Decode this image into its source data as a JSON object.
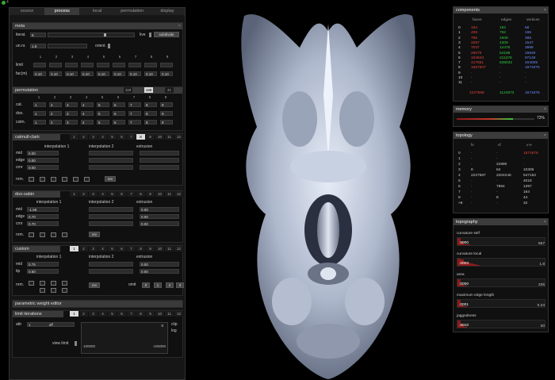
{
  "window": {
    "indicator": "4"
  },
  "tabs": [
    "source",
    "process",
    "local",
    "permutation",
    "display"
  ],
  "meta": {
    "title": "meta",
    "iterat_label": "iterat.",
    "iterat_value": "8",
    "live_label": "live",
    "subdivide_label": "subdivide",
    "unnr_label": "un.nr.",
    "unnr_value": "1.8",
    "orient_label": "orient.",
    "cols": [
      "1",
      "2",
      "3",
      "4",
      "5",
      "6",
      "7",
      "8",
      "9"
    ],
    "limit_label": "limit",
    "fac_label": "fac(m)",
    "fac_values": [
      "0.10",
      "0.10",
      "0.10",
      "0.10",
      "0.10",
      "0.10",
      "0.10",
      "0.10",
      "0.10"
    ]
  },
  "permutation": {
    "title": "permutation",
    "tabs": [
      "119",
      "188",
      "41"
    ],
    "cols": [
      "1",
      "2",
      "3",
      "4",
      "5",
      "6",
      "7",
      "8",
      "9"
    ],
    "rows": [
      {
        "label": "cat.",
        "values": [
          "1",
          "2",
          "3",
          "4",
          "5",
          "6",
          "7",
          "8",
          "9"
        ]
      },
      {
        "label": "doo.",
        "values": [
          "1",
          "2",
          "3",
          "4",
          "5",
          "6",
          "7",
          "8",
          "9"
        ]
      },
      {
        "label": "cstm.",
        "values": [
          "1",
          "2",
          "3",
          "4",
          "5",
          "6",
          "7",
          "8",
          "9"
        ]
      }
    ]
  },
  "catmull": {
    "title": "catmull-clark",
    "tabs": [
      "1",
      "2",
      "3",
      "4",
      "5",
      "6",
      "7",
      "8",
      "9",
      "10",
      "11",
      "12"
    ],
    "interp1": "interpolation 1",
    "interp2": "interpolation 2",
    "extrusion": "extrusion",
    "rows": [
      {
        "label": "mid",
        "v": "0.00"
      },
      {
        "label": "edge",
        "v": "0.00"
      },
      {
        "label": "crnr",
        "v": "0.00"
      }
    ],
    "nrm_label": "nrm.",
    "rev_label": "rev"
  },
  "doosabin": {
    "title": "doo-sabin",
    "tabs": [
      "1",
      "2",
      "3",
      "4",
      "5",
      "6",
      "7",
      "8",
      "9",
      "10",
      "11",
      "12"
    ],
    "interp1": "interpolation 1",
    "interp2": "interpolation 2",
    "extrusion": "extrusion",
    "rows": [
      {
        "label": "mid",
        "v": "-1.59",
        "ext": "0.00"
      },
      {
        "label": "edge",
        "v": "0.70",
        "ext": "0.00"
      },
      {
        "label": "crnr",
        "v": "0.70",
        "ext": "0.00"
      }
    ],
    "nrm_label": "nrm.",
    "rev_label": "rev"
  },
  "custom": {
    "title": "custom",
    "tabs": [
      "1",
      "2",
      "3",
      "4",
      "5",
      "6",
      "7",
      "8",
      "9",
      "10",
      "11",
      "12"
    ],
    "interp1": "interpolation 1",
    "interp2": "interpolation 2",
    "extrusion": "extrusion",
    "rows": [
      {
        "label": "mid",
        "v": "0.75",
        "ext": "0.00"
      },
      {
        "label": "tip",
        "v": "0.50",
        "ext": "0.00"
      }
    ],
    "nrm_label": "nrm.",
    "rev_label": "rev",
    "omit_label": "omit",
    "omit_values": [
      "0",
      "1",
      "2",
      "3"
    ]
  },
  "pwe": {
    "title": "parametric weight editor"
  },
  "limit_iter": {
    "title": "limit iterations",
    "tabs": [
      "1",
      "2",
      "3",
      "4",
      "5",
      "6",
      "7",
      "8",
      "9",
      "10",
      "11",
      "12"
    ],
    "attr_label": "attr",
    "attr_id": "1",
    "attr_value": "off",
    "zero": "0",
    "clip_label": "clip",
    "log_label": "log",
    "view_limit_label": "view limit",
    "v_left": "100000",
    "v_right": "-100000"
  },
  "components": {
    "title": "components",
    "headers": [
      "faces",
      "edges",
      "vertices"
    ],
    "rows": [
      [
        "0",
        "184",
        "192",
        "68"
      ],
      [
        "1",
        "408",
        "792",
        "196"
      ],
      [
        "2",
        "786",
        "1608",
        "385"
      ],
      [
        "3",
        "2087",
        "4309",
        "1547"
      ],
      [
        "4",
        "7047",
        "14476",
        "3998"
      ],
      [
        "5",
        "26079",
        "54188",
        "15849"
      ],
      [
        "6",
        "104943",
        "211378",
        "97148"
      ],
      [
        "7",
        "417651",
        "838032",
        "404009"
      ],
      [
        "8",
        "1667607",
        "-",
        "1671976"
      ],
      [
        "9",
        "-",
        "-",
        "-"
      ],
      [
        "10",
        "-",
        "-",
        "-"
      ],
      [
        "11",
        "-",
        "-",
        "-"
      ]
    ],
    "totals": [
      "2227586",
      "1124973",
      "1671976"
    ]
  },
  "memory": {
    "title": "memory",
    "percent": "72%",
    "fraction": 0.72
  },
  "topology": {
    "title": "topology",
    "headers": [
      "fx",
      "vf",
      "v-e"
    ],
    "rows": [
      [
        "0",
        "-",
        "-",
        "1671976"
      ],
      [
        "1",
        "-",
        "-",
        "-"
      ],
      [
        "2",
        "-",
        "22880",
        "-"
      ],
      [
        "3",
        "8",
        "64",
        "10306"
      ],
      [
        "4",
        "2227587",
        "2204246",
        "547152"
      ],
      [
        "5",
        "-",
        "-",
        "4018"
      ],
      [
        "6",
        "-",
        "7894",
        "1397"
      ],
      [
        "7",
        "-",
        "-",
        "184"
      ],
      [
        "8",
        "-",
        "8",
        "44"
      ],
      [
        ">8",
        "-",
        "-",
        "32"
      ]
    ]
  },
  "topography": {
    "title": "topography",
    "bars": [
      {
        "label": "curvature self",
        "left": ".0000",
        "right": "557"
      },
      {
        "label": "curvature local",
        "left": ".0003",
        "right": "1.8"
      },
      {
        "label": "area",
        "left": ".0000",
        "right": "225"
      },
      {
        "label": "maximum edge length",
        "left": ".0001",
        "right": "0.24"
      },
      {
        "label": "jaggedness",
        "left": ".0010",
        "right": "20"
      }
    ]
  },
  "colors": {
    "accent_red": "#c0392b",
    "green": "#2ecc40",
    "blue": "#6b8cff",
    "yellow": "#e6d84a"
  }
}
